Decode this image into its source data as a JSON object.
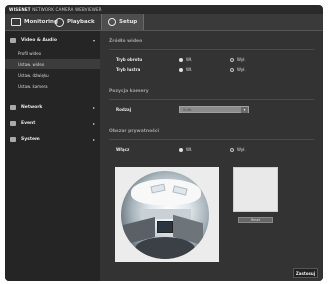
{
  "app": {
    "brand_prefix": "WISENET",
    "brand_rest": "NETWORK CAMERA WEBVIEWER"
  },
  "tabs": [
    {
      "label": "Monitoring",
      "icon": "monitor-icon"
    },
    {
      "label": "Playback",
      "icon": "playback-icon"
    },
    {
      "label": "Setup",
      "icon": "gear-icon",
      "active": true
    }
  ],
  "sidebar": {
    "menus": [
      {
        "label": "Video & Audio",
        "icon": "video-icon",
        "expanded": true
      },
      {
        "label": "Network",
        "icon": "network-icon"
      },
      {
        "label": "Event",
        "icon": "event-icon"
      },
      {
        "label": "System",
        "icon": "system-icon"
      }
    ],
    "submenu": [
      {
        "label": "Profil wideo"
      },
      {
        "label": "Ustaw. wideo",
        "selected": true
      },
      {
        "label": "Ustaw. dźwięku"
      },
      {
        "label": "Ustaw. kamera"
      }
    ]
  },
  "main": {
    "section_source": "Źródło wideo",
    "row1": {
      "label": "Tryb obrotu",
      "opt_on": "Wł.",
      "opt_off": "Wył.",
      "selected": "Wł."
    },
    "row2": {
      "label": "Tryb lustra",
      "opt_on": "Wł.",
      "opt_off": "Wył.",
      "selected": "Wł."
    },
    "section_camera": "Pozycja kamery",
    "row3": {
      "label": "Rodzaj",
      "value": "Sufit"
    },
    "section_privacy": "Obszar prywatności",
    "row4": {
      "label": "Włącz",
      "opt_on": "Wł.",
      "opt_off": "Wył.",
      "selected": "Wł."
    },
    "reset_label": "Reset",
    "apply_label": "Zastosuj"
  },
  "colors": {
    "background": "#333333",
    "sidebar": "#252525",
    "topbar": "#3a3a3a"
  }
}
